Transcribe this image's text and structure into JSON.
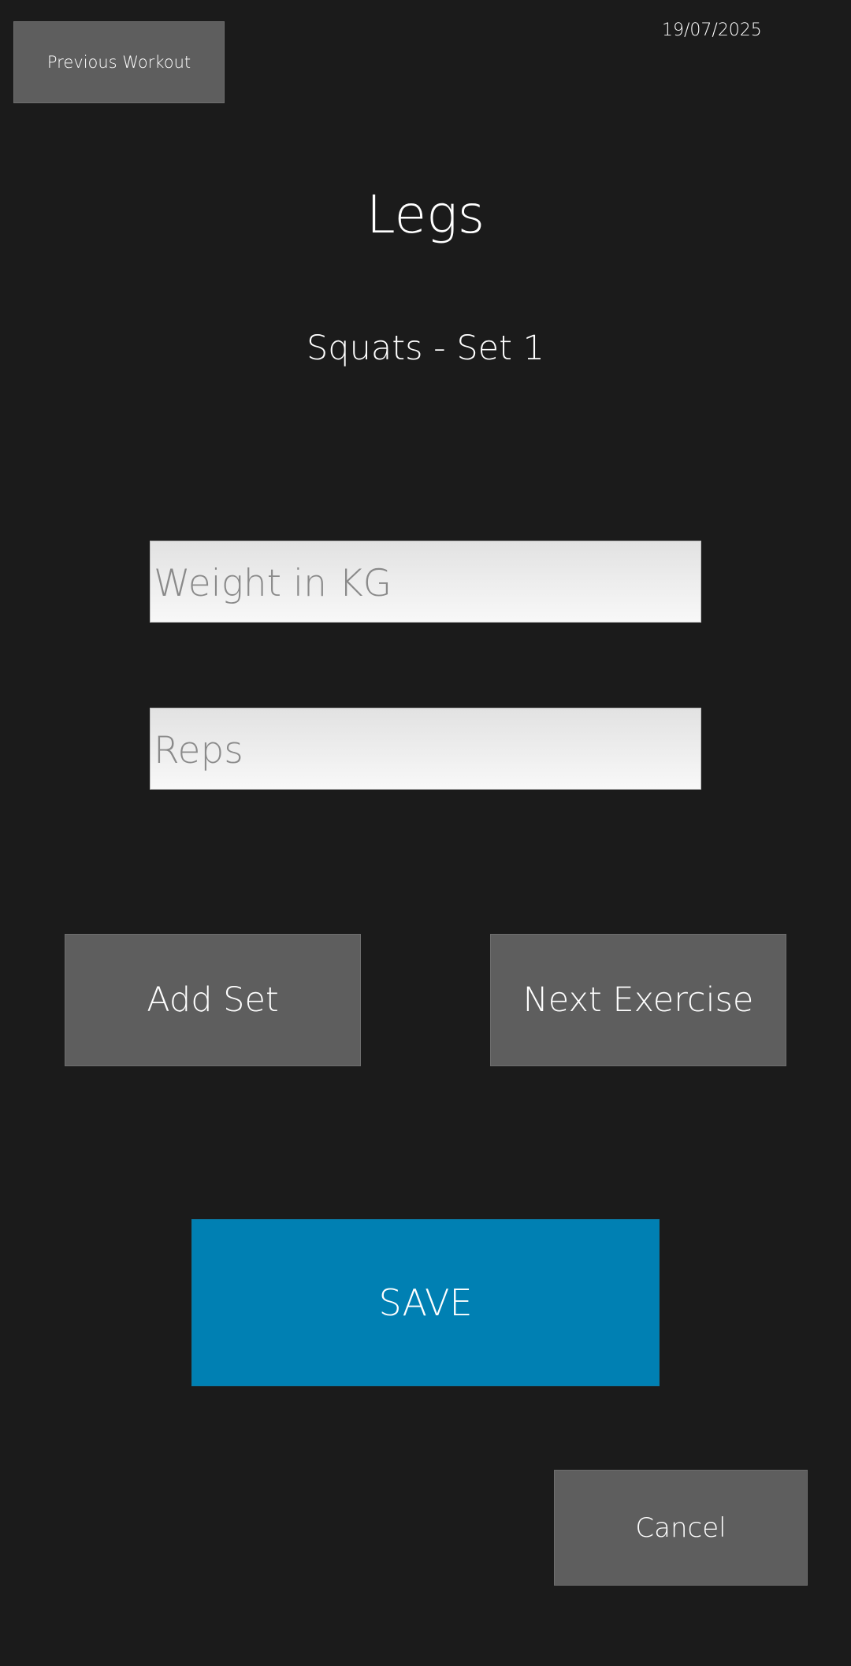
{
  "header": {
    "previous_workout_label": "Previous Workout",
    "date": "19/07/2025"
  },
  "workout": {
    "title": "Legs",
    "exercise_line": "Squats - Set 1"
  },
  "inputs": {
    "weight": {
      "value": "",
      "placeholder": "Weight in KG"
    },
    "reps": {
      "value": "",
      "placeholder": "Reps"
    }
  },
  "actions": {
    "add_set_label": "Add Set",
    "next_exercise_label": "Next Exercise",
    "save_label": "SAVE",
    "cancel_label": "Cancel"
  },
  "colors": {
    "background": "#1b1b1b",
    "button_gray": "#5e5e5e",
    "save_blue": "#0080b3",
    "text": "#ffffff"
  }
}
